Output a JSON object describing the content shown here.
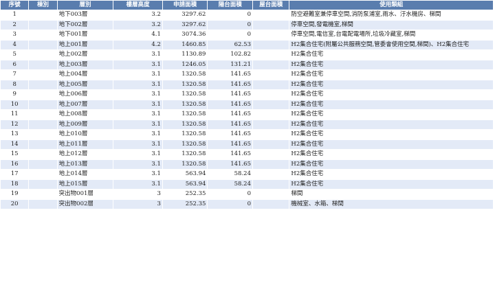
{
  "table": {
    "headers": [
      "序號",
      "棟別",
      "層別",
      "樓層高度",
      "申請面積",
      "陽台面積",
      "屋台面積",
      "使用類組"
    ],
    "rows": [
      {
        "no": "1",
        "bldg": "",
        "floor": "地下003層",
        "height": "3.2",
        "area": "3297.62",
        "balcony": "0",
        "roof": "",
        "usage": "防空避難室兼停車空間,消防泵浦室,雨水、汙水機房、梯間"
      },
      {
        "no": "2",
        "bldg": "",
        "floor": "地下002層",
        "height": "3.2",
        "area": "3297.62",
        "balcony": "0",
        "roof": "",
        "usage": "停車空間,發電機室,梯間"
      },
      {
        "no": "3",
        "bldg": "",
        "floor": "地下001層",
        "height": "4.1",
        "area": "3074.36",
        "balcony": "0",
        "roof": "",
        "usage": "停車空間,電信室,台電配電場所,垃圾冷藏室,梯間"
      },
      {
        "no": "4",
        "bldg": "",
        "floor": "地上001層",
        "height": "4.2",
        "area": "1460.85",
        "balcony": "62.53",
        "roof": "",
        "usage": "H2集合住宅(附屬公共服務空間,管委會使用空間,梯間)、H2集合住宅"
      },
      {
        "no": "5",
        "bldg": "",
        "floor": "地上002層",
        "height": "3.1",
        "area": "1130.89",
        "balcony": "102.82",
        "roof": "",
        "usage": "H2集合住宅"
      },
      {
        "no": "6",
        "bldg": "",
        "floor": "地上003層",
        "height": "3.1",
        "area": "1246.05",
        "balcony": "131.21",
        "roof": "",
        "usage": "H2集合住宅"
      },
      {
        "no": "7",
        "bldg": "",
        "floor": "地上004層",
        "height": "3.1",
        "area": "1320.58",
        "balcony": "141.65",
        "roof": "",
        "usage": "H2集合住宅"
      },
      {
        "no": "8",
        "bldg": "",
        "floor": "地上005層",
        "height": "3.1",
        "area": "1320.58",
        "balcony": "141.65",
        "roof": "",
        "usage": "H2集合住宅"
      },
      {
        "no": "9",
        "bldg": "",
        "floor": "地上006層",
        "height": "3.1",
        "area": "1320.58",
        "balcony": "141.65",
        "roof": "",
        "usage": "H2集合住宅"
      },
      {
        "no": "10",
        "bldg": "",
        "floor": "地上007層",
        "height": "3.1",
        "area": "1320.58",
        "balcony": "141.65",
        "roof": "",
        "usage": "H2集合住宅"
      },
      {
        "no": "11",
        "bldg": "",
        "floor": "地上008層",
        "height": "3.1",
        "area": "1320.58",
        "balcony": "141.65",
        "roof": "",
        "usage": "H2集合住宅"
      },
      {
        "no": "12",
        "bldg": "",
        "floor": "地上009層",
        "height": "3.1",
        "area": "1320.58",
        "balcony": "141.65",
        "roof": "",
        "usage": "H2集合住宅"
      },
      {
        "no": "13",
        "bldg": "",
        "floor": "地上010層",
        "height": "3.1",
        "area": "1320.58",
        "balcony": "141.65",
        "roof": "",
        "usage": "H2集合住宅"
      },
      {
        "no": "14",
        "bldg": "",
        "floor": "地上011層",
        "height": "3.1",
        "area": "1320.58",
        "balcony": "141.65",
        "roof": "",
        "usage": "H2集合住宅"
      },
      {
        "no": "15",
        "bldg": "",
        "floor": "地上012層",
        "height": "3.1",
        "area": "1320.58",
        "balcony": "141.65",
        "roof": "",
        "usage": "H2集合住宅"
      },
      {
        "no": "16",
        "bldg": "",
        "floor": "地上013層",
        "height": "3.1",
        "area": "1320.58",
        "balcony": "141.65",
        "roof": "",
        "usage": "H2集合住宅"
      },
      {
        "no": "17",
        "bldg": "",
        "floor": "地上014層",
        "height": "3.1",
        "area": "563.94",
        "balcony": "58.24",
        "roof": "",
        "usage": "H2集合住宅"
      },
      {
        "no": "18",
        "bldg": "",
        "floor": "地上015層",
        "height": "3.1",
        "area": "563.94",
        "balcony": "58.24",
        "roof": "",
        "usage": "H2集合住宅"
      },
      {
        "no": "19",
        "bldg": "",
        "floor": "突出物001層",
        "height": "3",
        "area": "252.35",
        "balcony": "0",
        "roof": "",
        "usage": "梯間"
      },
      {
        "no": "20",
        "bldg": "",
        "floor": "突出物002層",
        "height": "3",
        "area": "252.35",
        "balcony": "0",
        "roof": "",
        "usage": "機械室、水箱、梯間"
      }
    ]
  },
  "colors": {
    "header_bg": "#5a7dae",
    "row_alt_bg": "#e3eaf7"
  }
}
